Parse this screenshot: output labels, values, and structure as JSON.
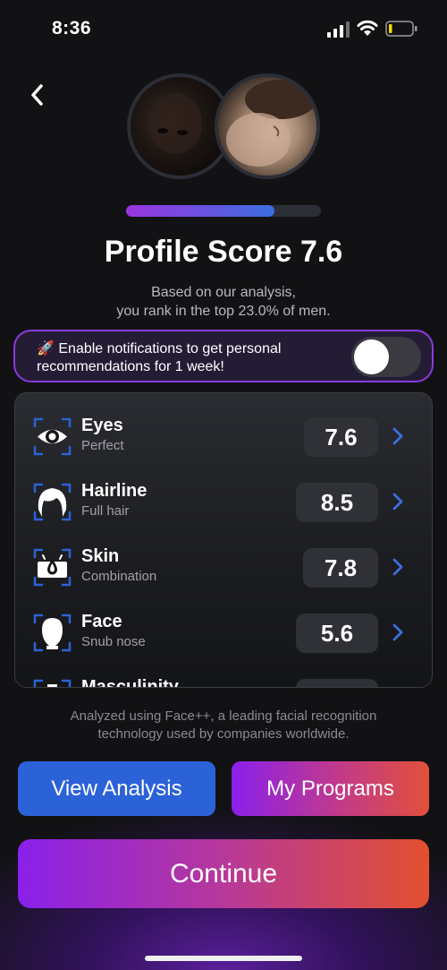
{
  "status_bar": {
    "time": "8:36"
  },
  "profile": {
    "progress": 0.76,
    "title": "Profile Score 7.6",
    "subtitle_line1": "Based on our analysis,",
    "subtitle_line2": "you rank in the top 23.0% of men."
  },
  "notification": {
    "line1": "🚀 Enable notifications to get personal",
    "line2": "recommendations for 1 week!",
    "toggle_on": false
  },
  "metrics": [
    {
      "name": "Eyes",
      "detail": "Perfect",
      "score": "7.6",
      "icon": "eye-icon"
    },
    {
      "name": "Hairline",
      "detail": "Full hair",
      "score": "8.5",
      "icon": "hair-icon"
    },
    {
      "name": "Skin",
      "detail": "Combination",
      "score": "7.8",
      "icon": "skin-icon"
    },
    {
      "name": "Face",
      "detail": "Snub nose",
      "score": "5.6",
      "icon": "face-icon"
    },
    {
      "name": "Masculinity",
      "detail": "",
      "score": "",
      "icon": "masculinity-icon"
    }
  ],
  "footnote": {
    "line1": "Analyzed using Face++, a leading facial recognition",
    "line2": "technology used by companies worldwide."
  },
  "buttons": {
    "view_analysis": "View Analysis",
    "my_programs": "My Programs",
    "continue": "Continue"
  },
  "colors": {
    "accent_blue": "#2c62d8",
    "accent_purple": "#8a20ea",
    "accent_orange": "#e2502e",
    "background": "#121214"
  }
}
